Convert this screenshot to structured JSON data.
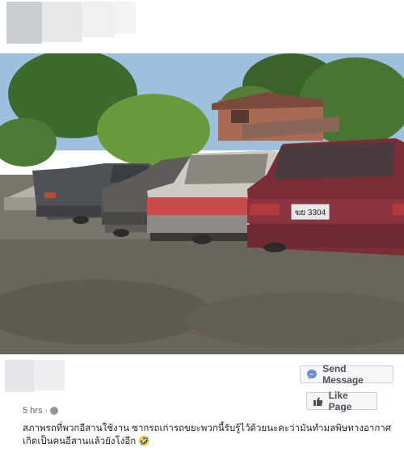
{
  "post": {
    "time": "5 hrs",
    "separator": "·",
    "caption": "สภาพรถที่พวกอีสานใช้งาน ซากรถเก่ารถขยะพวกนี้รับรู้ไว้ด้วยนะคะว่ามันทำมลพิษทางอากาศ เกิดเป็นคนอีสานแล้วยังโง่อีก 🤣",
    "license_plate": "ฆย 3304"
  },
  "actions": {
    "send_message": "Send Message",
    "like_page": "Like Page"
  },
  "colors": {
    "button_bg": "#f5f6f7",
    "button_text": "#4b4f56",
    "messenger_accent": "#6a8ec8",
    "thumb_accent": "#4b4f56"
  },
  "icons": {
    "messenger": "messenger-icon",
    "like": "thumbs-up-icon",
    "privacy": "globe-icon"
  }
}
